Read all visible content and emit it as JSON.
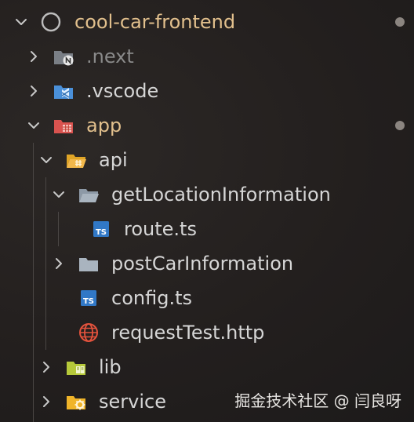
{
  "explorer": {
    "root": {
      "label": "cool-car-frontend",
      "expanded": true,
      "icon": "circle-icon",
      "color": "#e2c08d"
    },
    "items": [
      {
        "label": ".next",
        "expanded": false,
        "icon": "nextjs-folder-icon",
        "color": "#8a8a8a"
      },
      {
        "label": ".vscode",
        "expanded": false,
        "icon": "vscode-folder-icon",
        "color": "#d6d6d6"
      },
      {
        "label": "app",
        "expanded": true,
        "icon": "app-folder-icon",
        "color": "#e2c08d"
      },
      {
        "label": "api",
        "expanded": true,
        "icon": "api-folder-icon",
        "color": "#d6d6d6"
      },
      {
        "label": "getLocationInformation",
        "expanded": true,
        "icon": "folder-open-icon",
        "color": "#d6d6d6"
      },
      {
        "label": "route.ts",
        "icon": "typescript-file-icon",
        "color": "#d6d6d6"
      },
      {
        "label": "postCarInformation",
        "expanded": false,
        "icon": "folder-icon",
        "color": "#d6d6d6"
      },
      {
        "label": "config.ts",
        "icon": "typescript-file-icon",
        "color": "#d6d6d6"
      },
      {
        "label": "requestTest.http",
        "icon": "http-globe-icon",
        "color": "#d6d6d6"
      },
      {
        "label": "lib",
        "expanded": false,
        "icon": "lib-folder-icon",
        "color": "#d6d6d6"
      },
      {
        "label": "service",
        "expanded": false,
        "icon": "service-folder-icon",
        "color": "#d6d6d6"
      }
    ],
    "modified_dot_color": "#8b8580"
  },
  "watermark": {
    "text": "掘金技术社区 @ 闫良呀"
  }
}
